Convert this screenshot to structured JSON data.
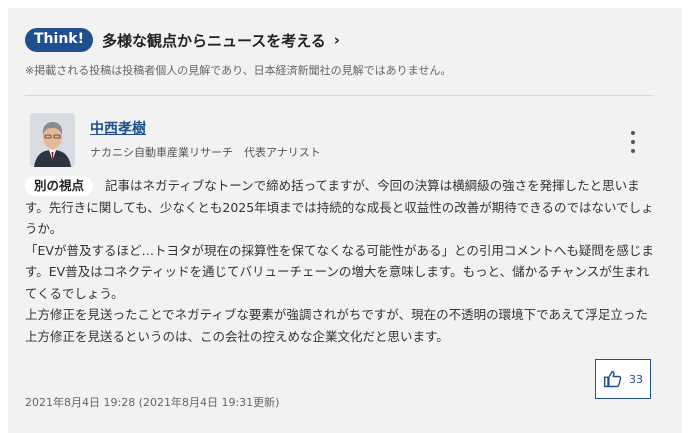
{
  "header": {
    "badge": "Think!",
    "title": "多様な観点からニュースを考える",
    "chevron": "›",
    "disclaimer": "※掲載される投稿は投稿者個人の見解であり、日本経済新聞社の見解ではありません。"
  },
  "comment": {
    "author_name": "中西孝樹",
    "author_title": "ナカニシ自動車産業リサーチ　代表アナリスト",
    "tag": "別の視点",
    "paragraphs": [
      "記事はネガティブなトーンで締め括ってますが、今回の決算は横綱級の強さを発揮したと思います。先行きに関しても、少なくとも2025年頃までは持続的な成長と収益性の改善が期待できるのではないでしょうか。",
      "「EVが普及するほど…トヨタが現在の採算性を保てなくなる可能性がある」との引用コメントへも疑問を感じます。EV普及はコネクティッドを通じてバリューチェーンの増大を意味します。もっと、儲かるチャンスが生まれてくるでしょう。",
      "上方修正を見送ったことでネガティブな要素が強調されがちですが、現在の不透明の環境下であえて浮足立った上方修正を見送るというのは、この会社の控えめな企業文化だと思います。"
    ],
    "timestamp": "2021年8月4日 19:28 (2021年8月4日 19:31更新)",
    "like_count": "33"
  },
  "icons": {
    "more": "kebab-menu-icon",
    "like": "thumbs-up-icon",
    "avatar": "author-portrait"
  },
  "colors": {
    "accent": "#1f4f8f",
    "panel_bg": "#f2f2f2"
  }
}
